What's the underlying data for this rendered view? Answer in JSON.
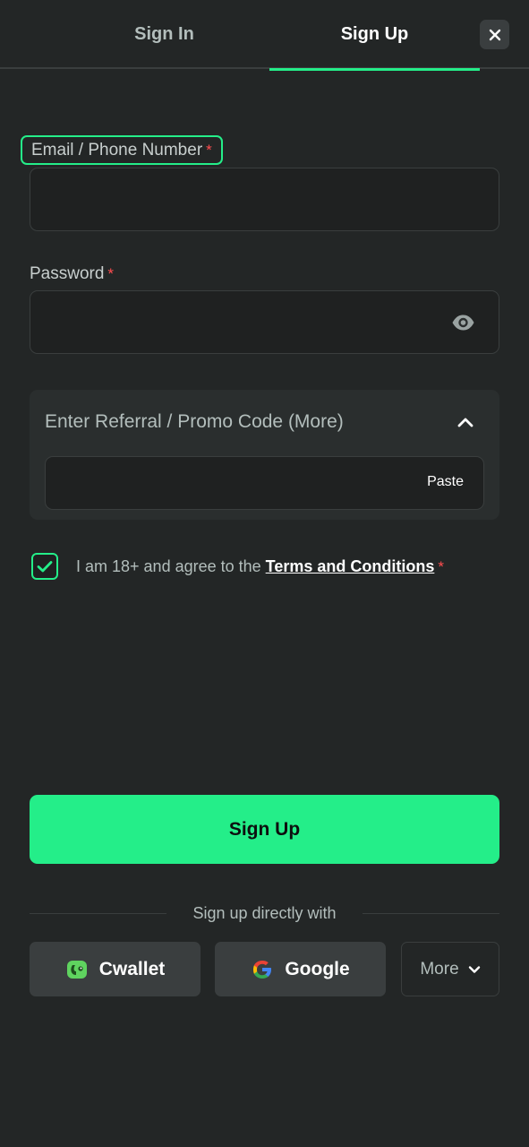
{
  "tabs": {
    "signin": "Sign In",
    "signup": "Sign Up"
  },
  "form": {
    "email_label": "Email / Phone Number",
    "email_value": "",
    "password_label": "Password",
    "password_value": "",
    "required_mark": "*"
  },
  "promo": {
    "title": "Enter Referral / Promo Code (More)",
    "value": "",
    "paste_label": "Paste"
  },
  "agreement": {
    "checked": true,
    "text": "I am 18+ and agree to the ",
    "link": "Terms and Conditions"
  },
  "submit_label": "Sign Up",
  "social": {
    "divider_text": "Sign up directly with",
    "cwallet": "Cwallet",
    "google": "Google",
    "more": "More"
  },
  "colors": {
    "accent": "#24ee89",
    "background": "#232626",
    "required": "#ff4d4f"
  },
  "icons": [
    "close-icon",
    "eye-icon",
    "chevron-up-icon",
    "check-icon",
    "cwallet-icon",
    "google-icon",
    "chevron-down-icon"
  ]
}
